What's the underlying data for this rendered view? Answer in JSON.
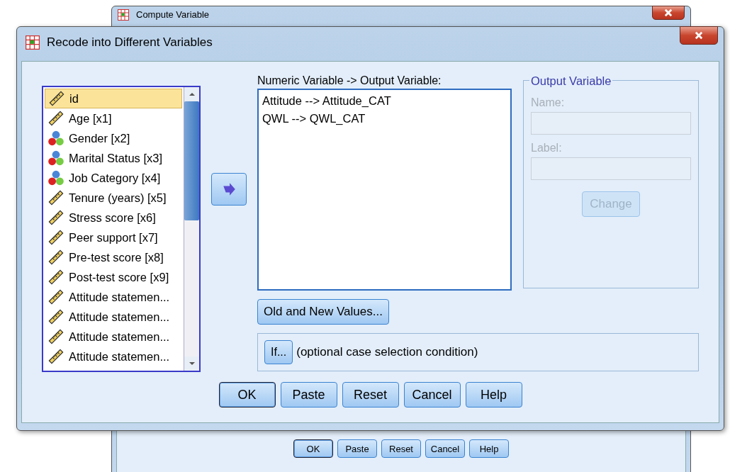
{
  "back_window": {
    "title": "Compute Variable",
    "buttons": [
      {
        "label": "OK",
        "default": true
      },
      {
        "label": "Paste",
        "default": false
      },
      {
        "label": "Reset",
        "default": false
      },
      {
        "label": "Cancel",
        "default": false
      },
      {
        "label": "Help",
        "default": false
      }
    ]
  },
  "window": {
    "title": "Recode into Different Variables"
  },
  "variables": [
    {
      "name": "id",
      "kind": "scale",
      "selected": true
    },
    {
      "name": "Age [x1]",
      "kind": "scale",
      "selected": false
    },
    {
      "name": "Gender [x2]",
      "kind": "nominal",
      "selected": false
    },
    {
      "name": "Marital Status [x3]",
      "kind": "nominal",
      "selected": false
    },
    {
      "name": "Job Category [x4]",
      "kind": "nominal",
      "selected": false
    },
    {
      "name": "Tenure (years) [x5]",
      "kind": "scale",
      "selected": false
    },
    {
      "name": "Stress score [x6]",
      "kind": "scale",
      "selected": false
    },
    {
      "name": "Peer support [x7]",
      "kind": "scale",
      "selected": false
    },
    {
      "name": "Pre-test score [x8]",
      "kind": "scale",
      "selected": false
    },
    {
      "name": "Post-test score [x9]",
      "kind": "scale",
      "selected": false
    },
    {
      "name": "Attitude statemen...",
      "kind": "scale",
      "selected": false
    },
    {
      "name": "Attitude statemen...",
      "kind": "scale",
      "selected": false
    },
    {
      "name": "Attitude statemen...",
      "kind": "scale",
      "selected": false
    },
    {
      "name": "Attitude statemen...",
      "kind": "scale",
      "selected": false
    }
  ],
  "mapping": {
    "label": "Numeric Variable -> Output Variable:",
    "items": [
      "Attitude --> Attitude_CAT",
      "QWL --> QWL_CAT"
    ]
  },
  "output_variable": {
    "title": "Output Variable",
    "name_label": "Name:",
    "label_label": "Label:",
    "change_button": {
      "label": "Change",
      "disabled": true
    }
  },
  "old_new_button": "Old and New Values...",
  "if_button": "If...",
  "if_text": "(optional case selection condition)",
  "buttons": [
    {
      "label": "OK",
      "default": true
    },
    {
      "label": "Paste",
      "default": false
    },
    {
      "label": "Reset",
      "default": false
    },
    {
      "label": "Cancel",
      "default": false
    },
    {
      "label": "Help",
      "default": false
    }
  ]
}
